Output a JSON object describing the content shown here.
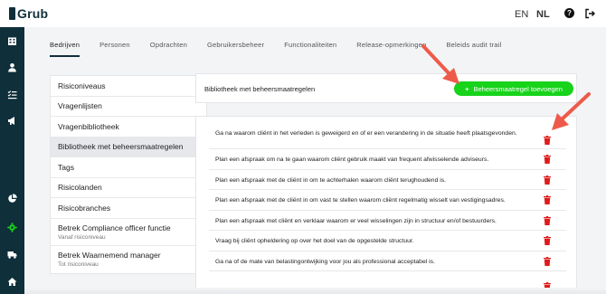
{
  "app": {
    "logo_text": "Grub"
  },
  "header": {
    "languages": [
      "EN",
      "NL"
    ],
    "active_language": "NL",
    "help_icon": "help-circle-icon",
    "logout_icon": "logout-icon"
  },
  "sidebar": {
    "icons": [
      "building-icon",
      "person-icon",
      "checklist-icon",
      "megaphone-icon",
      "pie-chart-icon",
      "gear-icon",
      "truck-icon",
      "home-icon"
    ],
    "active_icon": "gear-icon",
    "active_color": "#17d31a"
  },
  "tabs": [
    {
      "label": "Bedrijven",
      "active": true
    },
    {
      "label": "Personen",
      "active": false
    },
    {
      "label": "Opdrachten",
      "active": false
    },
    {
      "label": "Gebruikersbeheer",
      "active": false
    },
    {
      "label": "Functionaliteiten",
      "active": false
    },
    {
      "label": "Release-opmerkingen",
      "active": false
    },
    {
      "label": "Beleids audit trail",
      "active": false
    }
  ],
  "leftnav": [
    {
      "label": "Risiconiveaus",
      "sub": ""
    },
    {
      "label": "Vragenlijsten",
      "sub": ""
    },
    {
      "label": "Vragenbibliotheek",
      "sub": ""
    },
    {
      "label": "Bibliotheek met beheersmaatregelen",
      "sub": "",
      "active": true
    },
    {
      "label": "Tags",
      "sub": ""
    },
    {
      "label": "Risicolanden",
      "sub": ""
    },
    {
      "label": "Risicobranches",
      "sub": ""
    },
    {
      "label": "Betrek Compliance officer functie",
      "sub": "Vanaf risiconiveau"
    },
    {
      "label": "Betrek Waarnemend manager",
      "sub": "Tot risiconiveau"
    }
  ],
  "panel": {
    "title": "Bibliotheek met beheersmaatregelen",
    "add_button": "Beheersmaatregel toevoegen",
    "add_button_color": "#17d31a"
  },
  "measures": [
    "Ga na waarom cliënt in het verleden is geweigerd en of er een verandering in de situatie heeft plaatsgevonden.",
    "Plan een afspraak om na te gaan waarom cliënt gebruik maakt van frequent afwisselende adviseurs.",
    "Plan een afspraak met de cliënt in om te achterhalen waarom cliënt terughoudend is.",
    "Plan een afspraak met de cliënt in om vast te stellen waarom cliënt regelmatig wisselt van vestigingsadres.",
    "Plan een afspraak met cliënt en verklaar waarom er veel wisselingen zijn in structuur en/of bestuurders.",
    "Vraag bij cliënt opheldering op over het doel van de opgestelde structuur.",
    "Ga na of de mate van belastingontwijking voor jou als professional acceptabel is."
  ],
  "colors": {
    "sidebar_bg": "#0f2f3a",
    "delete_icon": "#e01b1b",
    "annotation_arrow": "#ee5a4a"
  }
}
